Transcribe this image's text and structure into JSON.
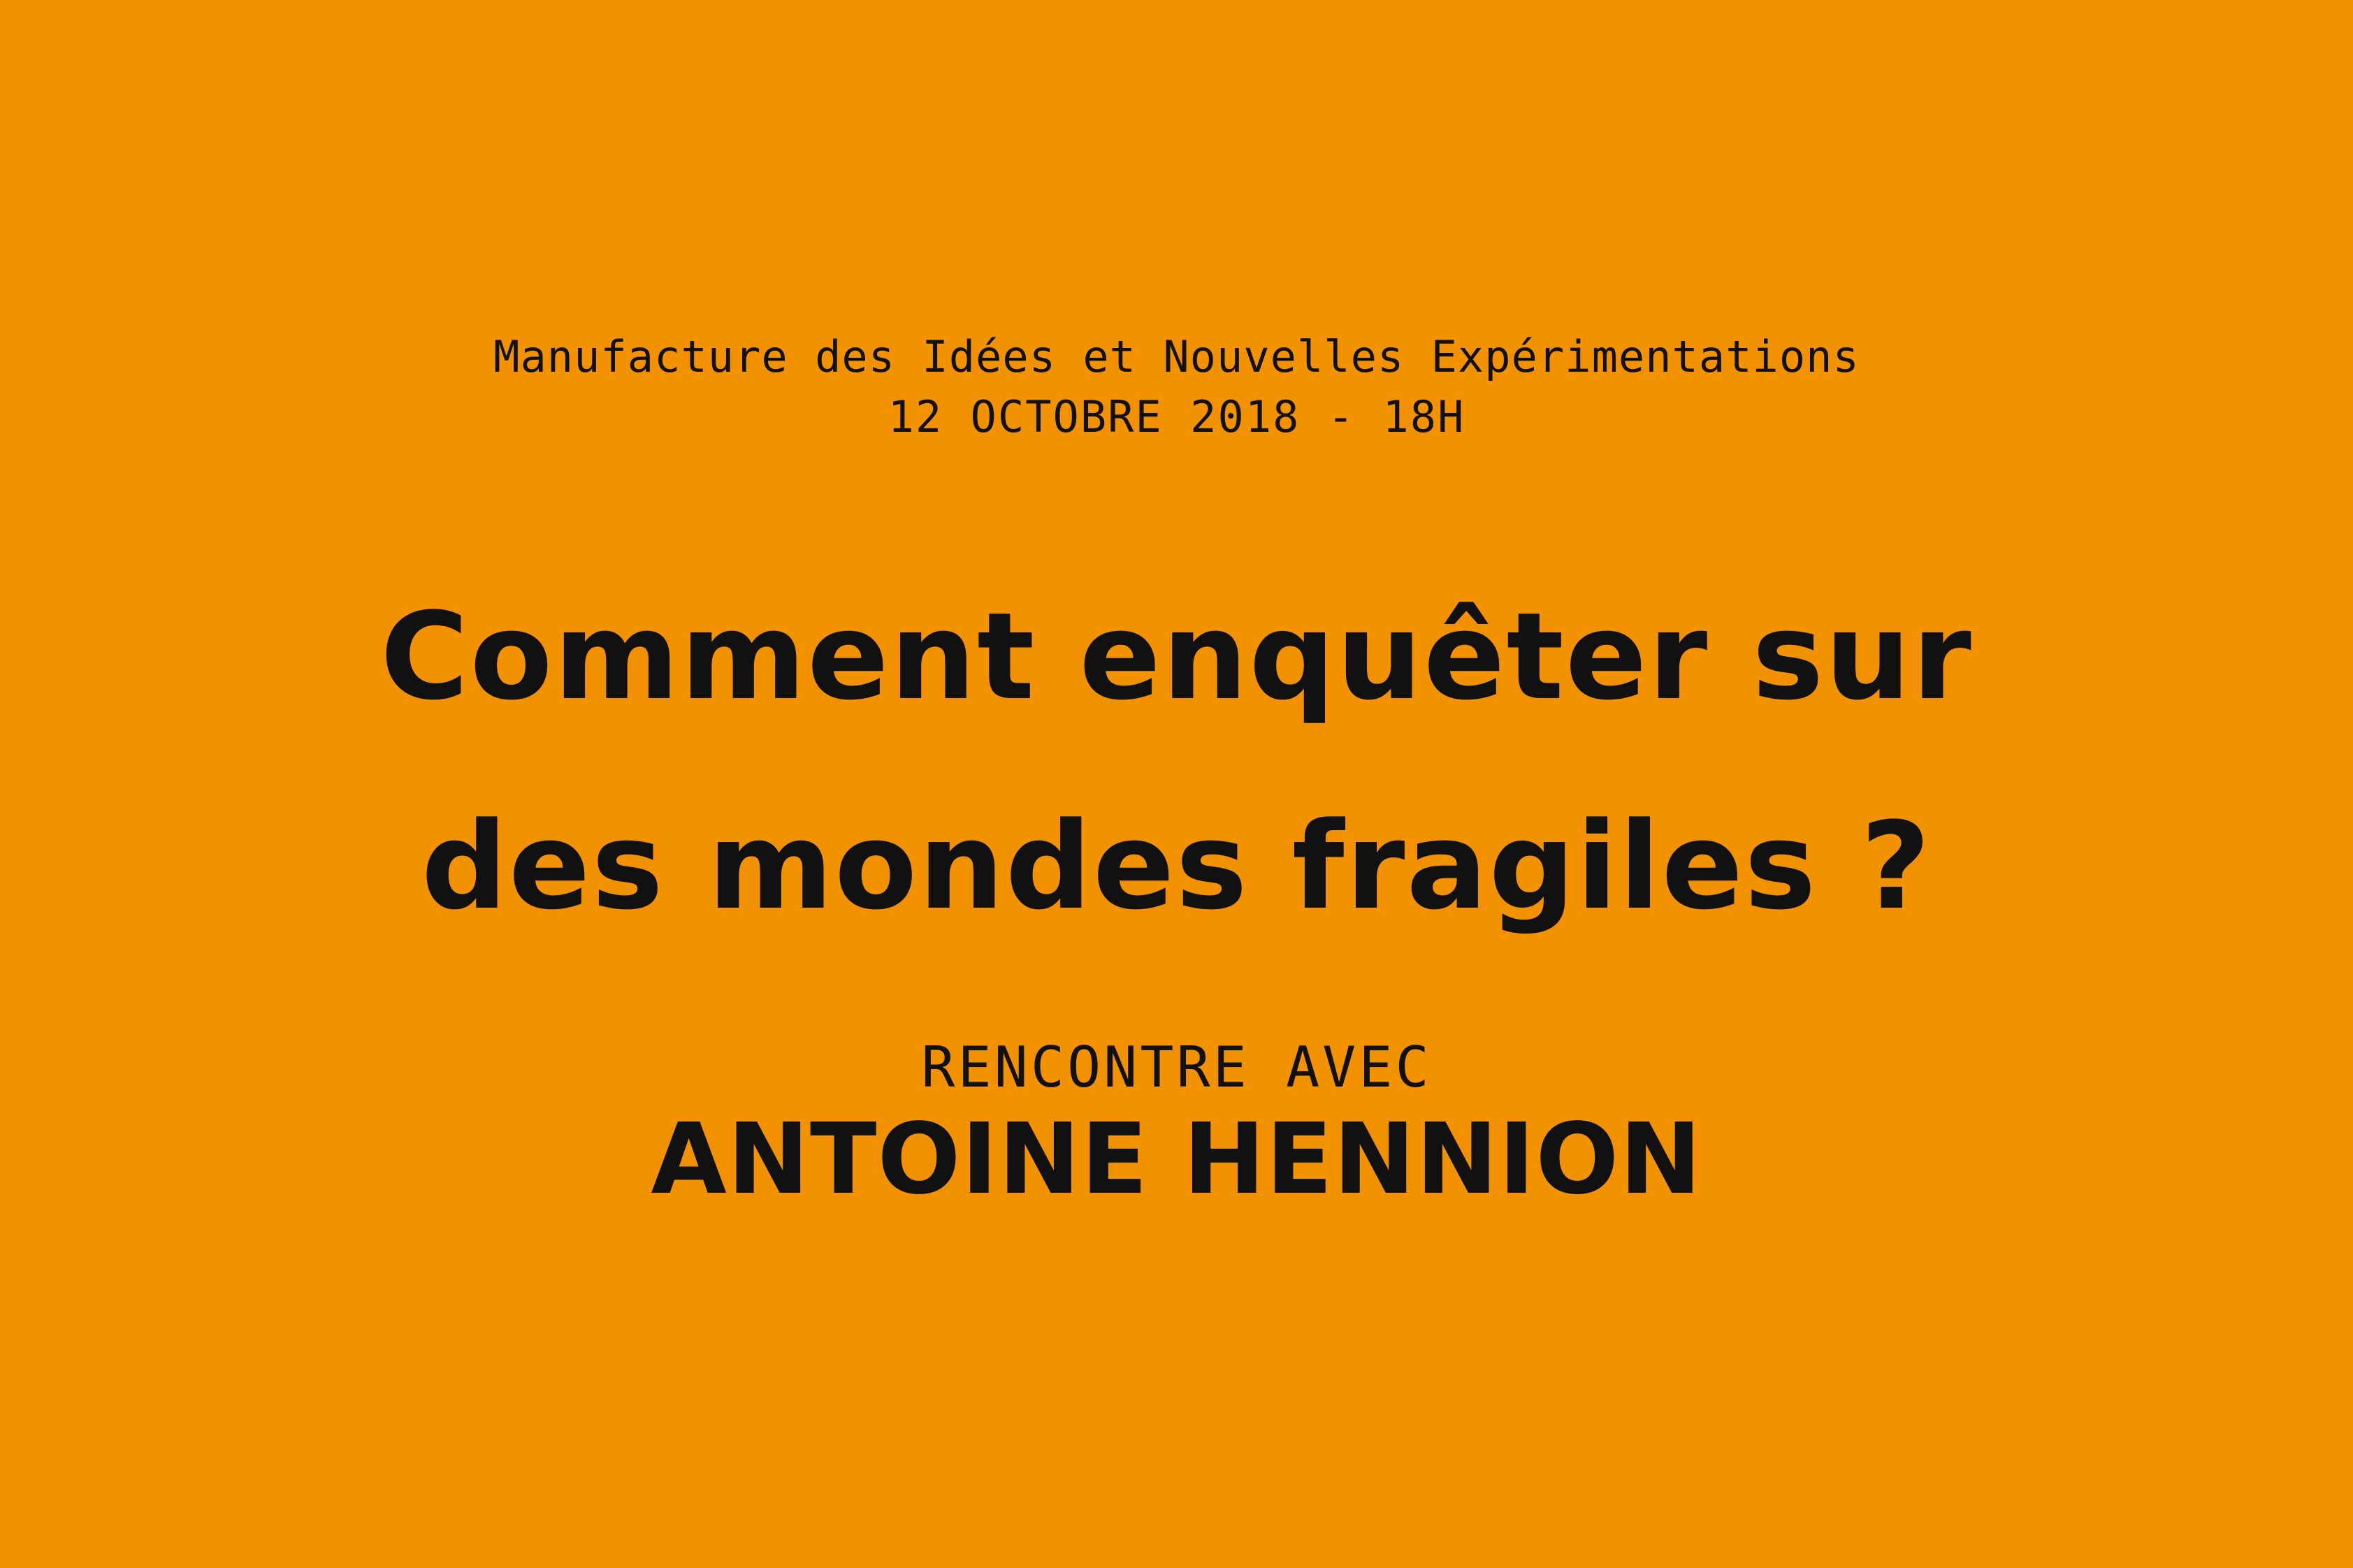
{
  "colors": {
    "background": "#f29200",
    "text": "#111111"
  },
  "event": {
    "venue": "Manufacture des Idées et Nouvelles Expérimentations",
    "date_time": "12 OCTOBRE 2018 - 18H",
    "title_line_1": "Comment enquêter sur",
    "title_line_2": "des mondes fragiles ?",
    "meeting_label": "RENCONTRE AVEC",
    "speaker": "ANTOINE HENNION"
  }
}
